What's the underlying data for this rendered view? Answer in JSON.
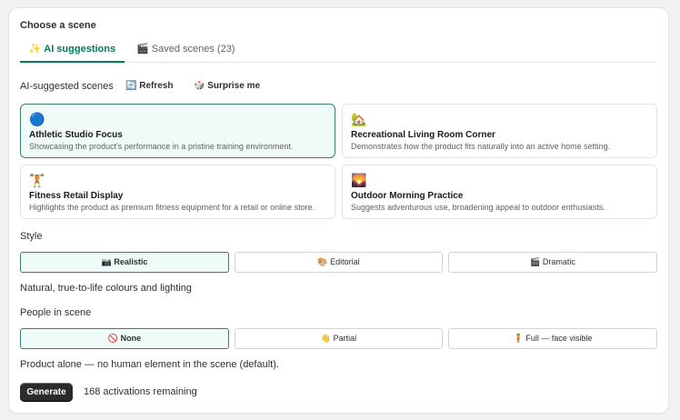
{
  "panel": {
    "title": "Choose a scene",
    "tabs": [
      {
        "label": "✨ AI suggestions"
      },
      {
        "label": "🎬 Saved scenes (23)"
      }
    ]
  },
  "suggestions": {
    "label": "AI-suggested scenes",
    "refresh_label": "🔄 Refresh",
    "surprise_label": "🎲 Surprise me",
    "scenes": [
      {
        "emoji": "🔵",
        "name": "Athletic Studio Focus",
        "description": "Showcasing the product's performance in a pristine training environment."
      },
      {
        "emoji": "🏡",
        "name": "Recreational Living Room Corner",
        "description": "Demonstrates how the product fits naturally into an active home setting."
      },
      {
        "emoji": "🏋️",
        "name": "Fitness Retail Display",
        "description": "Highlights the product as premium fitness equipment for a retail or online store."
      },
      {
        "emoji": "🌄",
        "name": "Outdoor Morning Practice",
        "description": "Suggests adventurous use, broadening appeal to outdoor enthusiasts."
      }
    ]
  },
  "style": {
    "label": "Style",
    "options": [
      {
        "label": "📷 Realistic"
      },
      {
        "label": "🎨 Editorial"
      },
      {
        "label": "🎬 Dramatic"
      }
    ],
    "description": "Natural, true-to-life colours and lighting"
  },
  "people": {
    "label": "People in scene",
    "options": [
      {
        "label": "🚫 None"
      },
      {
        "label": "👋 Partial"
      },
      {
        "label": "🧍 Full — face visible"
      }
    ],
    "description": "Product alone — no human element in the scene (default)."
  },
  "footer": {
    "generate_label": "Generate",
    "remaining_text": "168 activations remaining"
  },
  "colors": {
    "accent": "#007a5a",
    "selected_bg": "#effbf6",
    "selected_border": "#3a7f71",
    "button_dark": "#2b2b2b"
  }
}
